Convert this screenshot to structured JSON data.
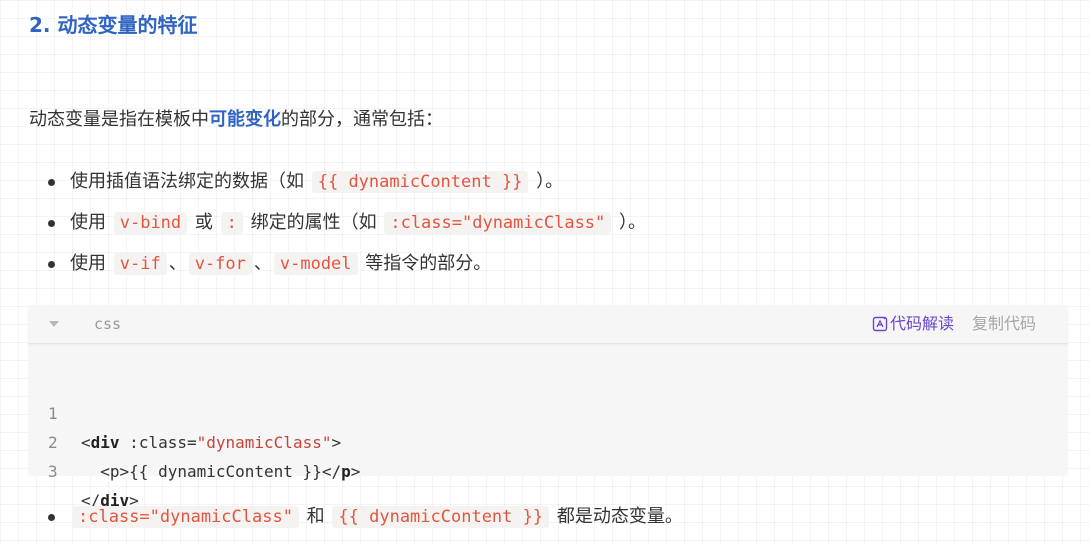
{
  "heading": "2. 动态变量的特征",
  "intro": {
    "before": "动态变量是指在模板中",
    "highlight": "可能变化",
    "after": "的部分，通常包括："
  },
  "list1": [
    {
      "t1": "使用插值语法绑定的数据（如",
      "c1": "{{ dynamicContent }}",
      "t2": "）。"
    },
    {
      "t1": "使用",
      "c1": "v-bind",
      "t2": "或",
      "c2": ":",
      "t3": "绑定的属性（如",
      "c3": ":class=\"dynamicClass\"",
      "t4": "）。"
    },
    {
      "t1": "使用",
      "c1": "v-if",
      "t2": "、",
      "c2": "v-for",
      "t3": "、",
      "c3": "v-model",
      "t4": "等指令的部分。"
    }
  ],
  "codeblock": {
    "lang": "css",
    "explain_label": "代码解读",
    "copy_label": "复制代码",
    "lines": [
      {
        "num": "1",
        "p1": "<",
        "tag1": "div",
        "p2": " :class=",
        "s1": "\"dynamicClass\"",
        "p3": ">"
      },
      {
        "num": "2",
        "p1": "  <p>{{ dynamicContent }}</",
        "tag1": "p",
        "p2": ">"
      },
      {
        "num": "3",
        "p1": "</",
        "tag1": "div",
        "p2": ">"
      }
    ]
  },
  "list2": [
    {
      "c1": ":class=\"dynamicClass\"",
      "t1": "和",
      "c2": "{{ dynamicContent }}",
      "t2": "都是动态变量。"
    }
  ],
  "colors": {
    "heading": "#2f64c2",
    "inline_code": "#e2553f",
    "explain": "#6b46c9"
  },
  "icons": {
    "collapse": "triangle-down-icon",
    "explain": "ai-explain-icon"
  }
}
